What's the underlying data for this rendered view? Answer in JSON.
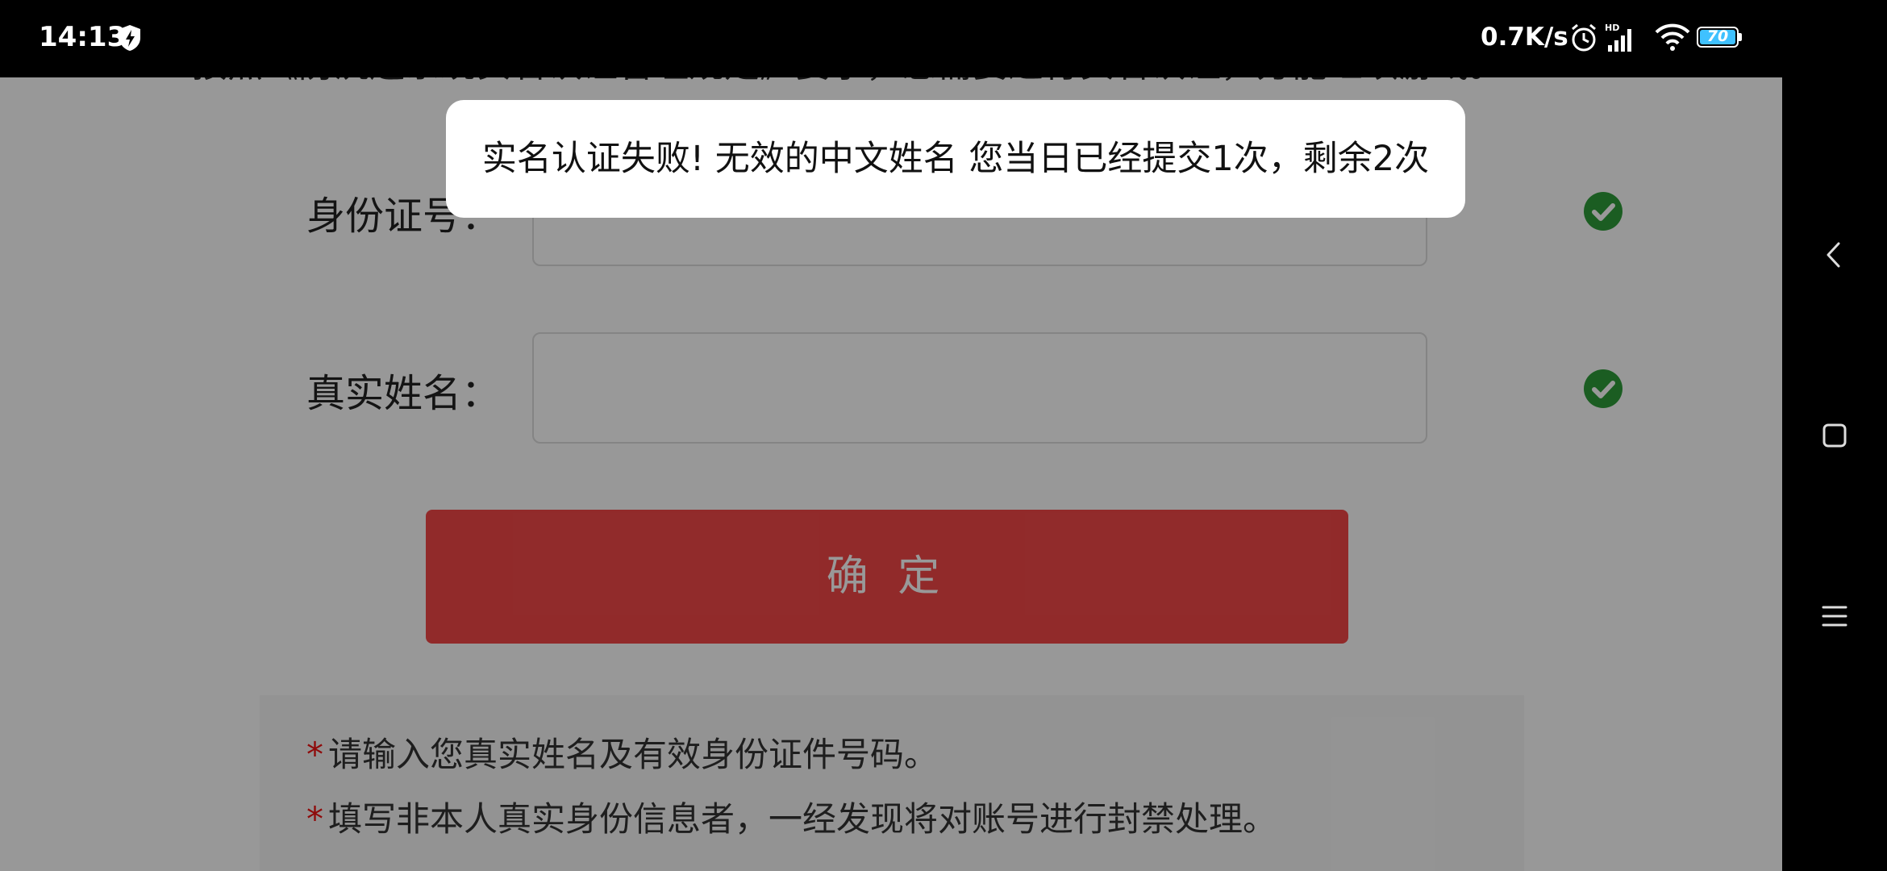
{
  "status_bar": {
    "time": "14:13",
    "speed": "0.7K/s",
    "hd_label": "HD",
    "battery": "70",
    "icons": [
      "shield-bolt-icon",
      "alarm-icon",
      "signal-icon",
      "wifi-icon",
      "battery-icon"
    ]
  },
  "page": {
    "cut_off_text": "按照《防沉迷系统实名认证管理规定》要求，您需要进行实名认证，方能继续游戏。",
    "id_label": "身份证号：",
    "id_value": "",
    "name_label": "真实姓名：",
    "name_value": "",
    "confirm_label": "确 定",
    "notes": [
      "请输入您真实姓名及有效身份证件号码。",
      "填写非本人真实身份信息者，一经发现将对账号进行封禁处理。"
    ],
    "note_marker": "*",
    "accent_color": "#f24747",
    "valid_color": "#2e9c3a"
  },
  "toast": {
    "message": "实名认证失败! 无效的中文姓名 您当日已经提交1次，剩余2次"
  },
  "nav": {
    "icons": [
      "back-icon",
      "recents-icon",
      "menu-icon"
    ]
  }
}
